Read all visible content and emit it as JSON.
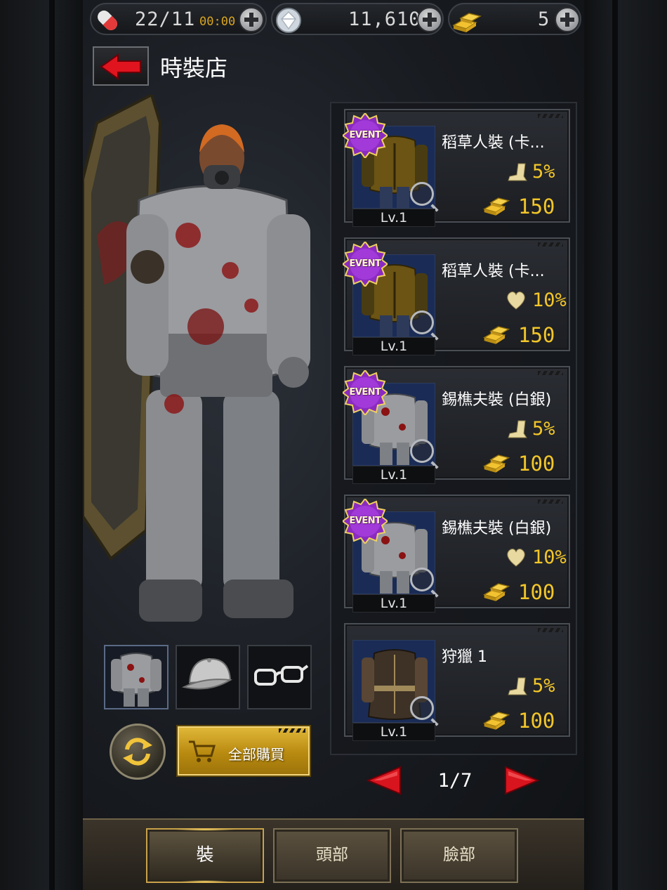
{
  "status": {
    "stamina": {
      "value": "22/11",
      "timer": "00:00",
      "icon": "stamina-pill-icon"
    },
    "gems": {
      "value": "11,610",
      "icon": "diamond-icon"
    },
    "gold": {
      "value": "5",
      "icon": "gold-bars-icon"
    }
  },
  "header": {
    "title": "時裝店",
    "back_icon": "back-arrow-icon"
  },
  "equip_slots": [
    {
      "name": "slot-outfit",
      "icon": "armor-icon",
      "active": true
    },
    {
      "name": "slot-head",
      "icon": "cap-icon",
      "active": false
    },
    {
      "name": "slot-face",
      "icon": "glasses-icon",
      "active": false
    }
  ],
  "actions": {
    "buy_all_label": "全部購買"
  },
  "items": [
    {
      "name": "稻草人裝 (卡...",
      "event": true,
      "event_label": "EVENT",
      "stat_type": "boot-icon",
      "stat": "5%",
      "price": "150",
      "level": "Lv.1",
      "thumb": "scarecrow"
    },
    {
      "name": "稻草人裝 (卡...",
      "event": true,
      "event_label": "EVENT",
      "stat_type": "heart-icon",
      "stat": "10%",
      "price": "150",
      "level": "Lv.1",
      "thumb": "scarecrow"
    },
    {
      "name": "錫樵夫裝 (白銀)",
      "event": true,
      "event_label": "EVENT",
      "stat_type": "boot-icon",
      "stat": "5%",
      "price": "100",
      "level": "Lv.1",
      "thumb": "tinman"
    },
    {
      "name": "錫樵夫裝 (白銀)",
      "event": true,
      "event_label": "EVENT",
      "stat_type": "heart-icon",
      "stat": "10%",
      "price": "100",
      "level": "Lv.1",
      "thumb": "tinman"
    },
    {
      "name": "狩獵 1",
      "event": false,
      "event_label": "",
      "stat_type": "boot-icon",
      "stat": "5%",
      "price": "100",
      "level": "Lv.1",
      "thumb": "hunter"
    }
  ],
  "pagination": {
    "current": "1/7"
  },
  "tabs": [
    {
      "label": "裝",
      "active": true
    },
    {
      "label": "頭部",
      "active": false
    },
    {
      "label": "臉部",
      "active": false
    }
  ],
  "colors": {
    "accent_gold": "#f3c628",
    "event_purple": "#8a2bc0",
    "arrow_red": "#d8141e"
  }
}
